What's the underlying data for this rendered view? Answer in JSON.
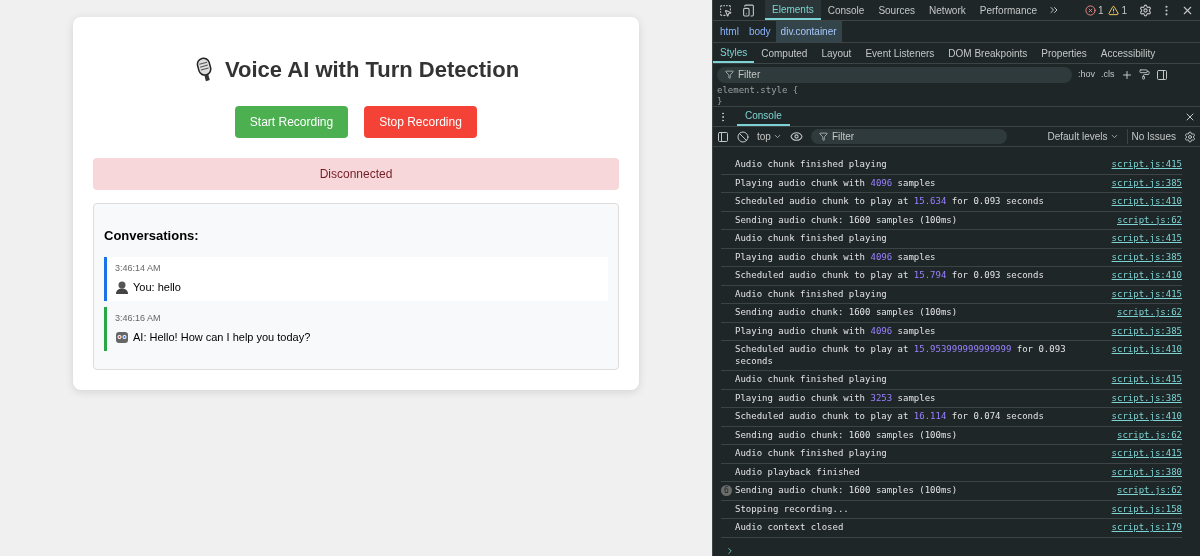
{
  "page": {
    "title": "Voice AI with Turn Detection",
    "buttons": [
      {
        "label": "Start Recording",
        "kind": "start"
      },
      {
        "label": "Stop Recording",
        "kind": "stop"
      }
    ],
    "status": "Disconnected",
    "conversations": {
      "heading": "Conversations:",
      "messages": [
        {
          "kind": "user",
          "time": "3:46:14 AM",
          "text": "You: hello"
        },
        {
          "kind": "ai",
          "time": "3:46:16 AM",
          "text": "AI: Hello! How can I help you today?"
        }
      ]
    }
  },
  "devtools": {
    "tabs": [
      {
        "label": "Elements",
        "selected": true
      },
      {
        "label": "Console",
        "selected": false
      },
      {
        "label": "Sources",
        "selected": false
      },
      {
        "label": "Network",
        "selected": false
      },
      {
        "label": "Performance",
        "selected": false
      }
    ],
    "errors": "1",
    "warnings": "1",
    "breadcrumbs": [
      {
        "label": "html",
        "selected": false
      },
      {
        "label": "body",
        "selected": false
      },
      {
        "label": "div.container",
        "selected": true
      }
    ],
    "style_tabs": [
      {
        "label": "Styles",
        "selected": true
      },
      {
        "label": "Computed",
        "selected": false
      },
      {
        "label": "Layout",
        "selected": false
      },
      {
        "label": "Event Listeners",
        "selected": false
      },
      {
        "label": "DOM Breakpoints",
        "selected": false
      },
      {
        "label": "Properties",
        "selected": false
      },
      {
        "label": "Accessibility",
        "selected": false
      }
    ],
    "styles_filter": {
      "placeholder": "Filter"
    },
    "hov": ":hov",
    "cls": ".cls",
    "style_rule": [
      "element.style {",
      "}"
    ],
    "drawer_tab": "Console",
    "console_toolbar": {
      "context": "top",
      "filter": {
        "placeholder": "Filter"
      },
      "levels": "Default levels",
      "issues": "No Issues"
    },
    "messages": [
      {
        "segments": [
          {
            "kind": "plain",
            "text": "Audio chunk finished playing"
          }
        ],
        "source": "script.js:415"
      },
      {
        "segments": [
          {
            "kind": "plain",
            "text": "Playing audio chunk with "
          },
          {
            "kind": "number",
            "text": "4096"
          },
          {
            "kind": "plain",
            "text": " samples"
          }
        ],
        "source": "script.js:385"
      },
      {
        "segments": [
          {
            "kind": "plain",
            "text": "Scheduled audio chunk to play at "
          },
          {
            "kind": "number",
            "text": "15.634"
          },
          {
            "kind": "plain",
            "text": " for 0.093 seconds"
          }
        ],
        "source": "script.js:410"
      },
      {
        "segments": [
          {
            "kind": "plain",
            "text": "Sending audio chunk: 1600 samples (100ms)"
          }
        ],
        "source": "script.js:62"
      },
      {
        "segments": [
          {
            "kind": "plain",
            "text": "Audio chunk finished playing"
          }
        ],
        "source": "script.js:415"
      },
      {
        "segments": [
          {
            "kind": "plain",
            "text": "Playing audio chunk with "
          },
          {
            "kind": "number",
            "text": "4096"
          },
          {
            "kind": "plain",
            "text": " samples"
          }
        ],
        "source": "script.js:385"
      },
      {
        "segments": [
          {
            "kind": "plain",
            "text": "Scheduled audio chunk to play at "
          },
          {
            "kind": "number",
            "text": "15.794"
          },
          {
            "kind": "plain",
            "text": " for 0.093 seconds"
          }
        ],
        "source": "script.js:410"
      },
      {
        "segments": [
          {
            "kind": "plain",
            "text": "Audio chunk finished playing"
          }
        ],
        "source": "script.js:415"
      },
      {
        "segments": [
          {
            "kind": "plain",
            "text": "Sending audio chunk: 1600 samples (100ms)"
          }
        ],
        "source": "script.js:62"
      },
      {
        "segments": [
          {
            "kind": "plain",
            "text": "Playing audio chunk with "
          },
          {
            "kind": "number",
            "text": "4096"
          },
          {
            "kind": "plain",
            "text": " samples"
          }
        ],
        "source": "script.js:385"
      },
      {
        "segments": [
          {
            "kind": "plain",
            "text": "Scheduled audio chunk to play at "
          },
          {
            "kind": "number",
            "text": "15.953999999999999"
          },
          {
            "kind": "plain",
            "text": " for 0.093 seconds"
          }
        ],
        "source": "script.js:410"
      },
      {
        "segments": [
          {
            "kind": "plain",
            "text": "Audio chunk finished playing"
          }
        ],
        "source": "script.js:415"
      },
      {
        "segments": [
          {
            "kind": "plain",
            "text": "Playing audio chunk with "
          },
          {
            "kind": "number",
            "text": "3253"
          },
          {
            "kind": "plain",
            "text": " samples"
          }
        ],
        "source": "script.js:385"
      },
      {
        "segments": [
          {
            "kind": "plain",
            "text": "Scheduled audio chunk to play at "
          },
          {
            "kind": "number",
            "text": "16.114"
          },
          {
            "kind": "plain",
            "text": " for 0.074 seconds"
          }
        ],
        "source": "script.js:410"
      },
      {
        "segments": [
          {
            "kind": "plain",
            "text": "Sending audio chunk: 1600 samples (100ms)"
          }
        ],
        "source": "script.js:62"
      },
      {
        "segments": [
          {
            "kind": "plain",
            "text": "Audio chunk finished playing"
          }
        ],
        "source": "script.js:415"
      },
      {
        "segments": [
          {
            "kind": "plain",
            "text": "Audio playback finished"
          }
        ],
        "source": "script.js:380"
      },
      {
        "count": "6",
        "segments": [
          {
            "kind": "plain",
            "text": "Sending audio chunk: 1600 samples (100ms)"
          }
        ],
        "source": "script.js:62"
      },
      {
        "segments": [
          {
            "kind": "plain",
            "text": "Stopping recording..."
          }
        ],
        "source": "script.js:158"
      },
      {
        "segments": [
          {
            "kind": "plain",
            "text": "Audio context closed"
          }
        ],
        "source": "script.js:179"
      }
    ]
  }
}
